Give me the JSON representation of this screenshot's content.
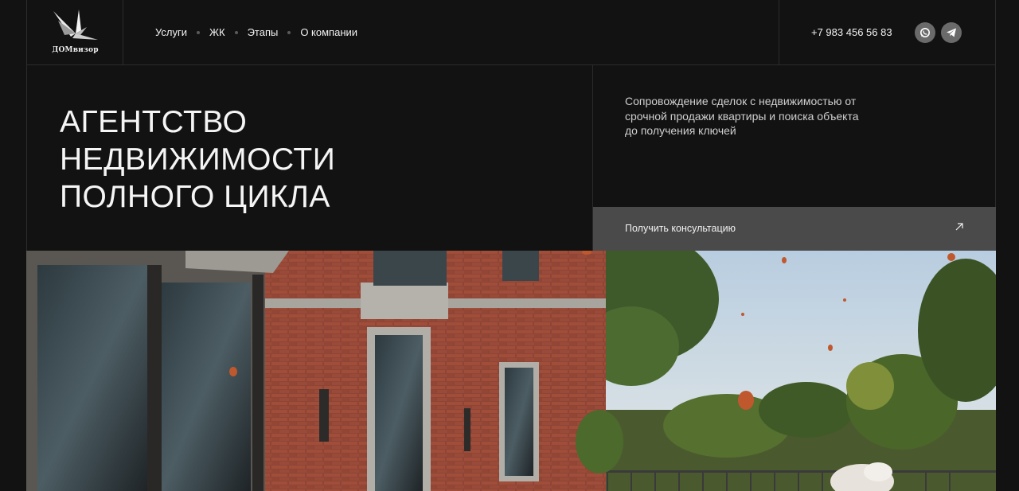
{
  "brand": {
    "name": "ДОМвизор"
  },
  "nav": {
    "items": [
      {
        "label": "Услуги"
      },
      {
        "label": "ЖК"
      },
      {
        "label": "Этапы"
      },
      {
        "label": "О компании"
      }
    ]
  },
  "contact": {
    "phone": "+7 983 456 56 83",
    "social": [
      {
        "icon": "whatsapp-icon"
      },
      {
        "icon": "telegram-icon"
      }
    ]
  },
  "hero": {
    "headline_lines": [
      "АГЕНТСТВО",
      "НЕДВИЖИМОСТИ",
      "ПОЛНОГО ЦИКЛА"
    ],
    "description": "Сопровождение сделок с недвижимостью от срочной продажи квартиры и поиска объекта до получения ключей",
    "cta_label": "Получить консультацию",
    "cta_icon": "arrow-up-right-icon"
  },
  "colors": {
    "background": "#121212",
    "cta_background": "#4a4a4a",
    "social_background": "#6a6a6a"
  }
}
